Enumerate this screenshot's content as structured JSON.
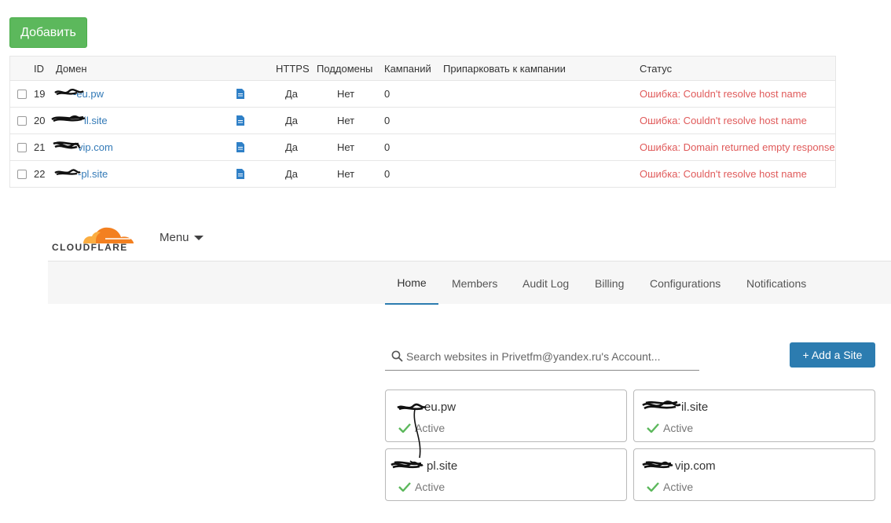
{
  "admin": {
    "add_button": "Добавить",
    "columns": {
      "id": "ID",
      "domain": "Домен",
      "https": "HTTPS",
      "subdomains": "Поддомены",
      "campaigns": "Кампаний",
      "park": "Припарковать к кампании",
      "status": "Статус"
    },
    "rows": [
      {
        "id": "19",
        "domain": "-eu.pw",
        "https": "Да",
        "subdomains": "Нет",
        "campaigns": "0",
        "status": "Ошибка: Couldn't resolve host name"
      },
      {
        "id": "20",
        "domain": "il.site",
        "https": "Да",
        "subdomains": "Нет",
        "campaigns": "0",
        "status": "Ошибка: Couldn't resolve host name"
      },
      {
        "id": "21",
        "domain": "vip.com",
        "https": "Да",
        "subdomains": "Нет",
        "campaigns": "0",
        "status": "Ошибка: Domain returned empty response"
      },
      {
        "id": "22",
        "domain": "-pl.site",
        "https": "Да",
        "subdomains": "Нет",
        "campaigns": "0",
        "status": "Ошибка: Couldn't resolve host name"
      }
    ],
    "status_color": "#e05a5a",
    "link_color": "#337ab7",
    "button_color": "#5cb85c"
  },
  "cloudflare": {
    "logo_text": "CLOUDFLARE",
    "menu_label": "Menu",
    "nav": [
      "Home",
      "Members",
      "Audit Log",
      "Billing",
      "Configurations",
      "Notifications"
    ],
    "active_nav": "Home",
    "search_placeholder": "Search websites in Privetfm@yandex.ru's Account...",
    "add_site_label": "+ Add a Site",
    "sites": [
      {
        "name": "-eu.pw",
        "status": "Active"
      },
      {
        "name": "il.site",
        "status": "Active"
      },
      {
        "name": "pl.site",
        "status": "Active"
      },
      {
        "name": "vip.com",
        "status": "Active"
      }
    ],
    "accent_color": "#2c7cb0",
    "logo_color": "#f38020",
    "active_color": "#5cb85c"
  }
}
